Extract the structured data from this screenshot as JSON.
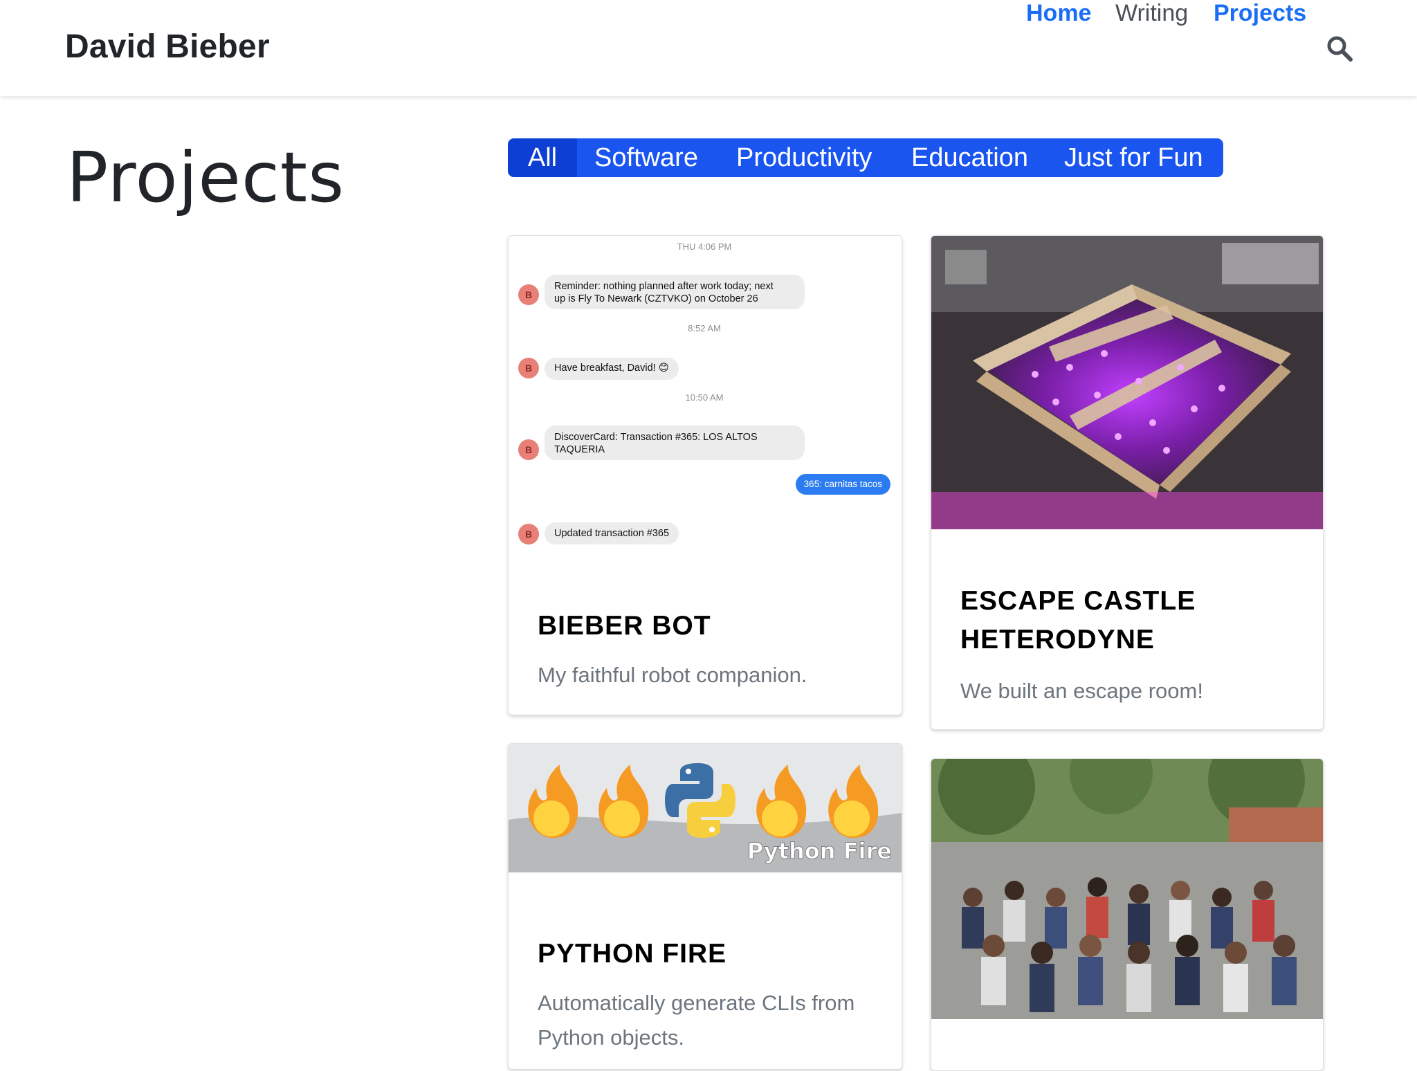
{
  "header": {
    "brand": "David Bieber",
    "nav": [
      {
        "label": "Home",
        "active": true
      },
      {
        "label": "Writing",
        "active": false
      },
      {
        "label": "Projects",
        "active": true
      }
    ]
  },
  "page": {
    "title": "Projects"
  },
  "filters": [
    {
      "label": "All",
      "selected": true
    },
    {
      "label": "Software",
      "selected": false
    },
    {
      "label": "Productivity",
      "selected": false
    },
    {
      "label": "Education",
      "selected": false
    },
    {
      "label": "Just for Fun",
      "selected": false
    }
  ],
  "cards": [
    {
      "title": "BIEBER BOT",
      "description": "My faithful robot companion.",
      "chat": {
        "times": [
          "THU 4:06 PM",
          "8:52 AM",
          "10:50 AM"
        ],
        "avatar_letter": "B",
        "messages": [
          {
            "line1": "Reminder: nothing planned after work today; next",
            "line2": "up is Fly To Newark (CZTVKO) on October 26"
          },
          {
            "line1": "Have breakfast, David! 😊"
          },
          {
            "line1": "DiscoverCard: Transaction #365: LOS ALTOS",
            "line2": "TAQUERIA"
          },
          {
            "line1": "Updated transaction #365"
          }
        ],
        "reply": "365: carnitas tacos"
      }
    },
    {
      "title_line1": "ESCAPE CASTLE",
      "title_line2": "HETERODYNE",
      "description": "We built an escape room!"
    },
    {
      "title": "PYTHON FIRE",
      "description_line1": "Automatically generate CLIs from",
      "description_line2": "Python objects.",
      "banner_text": "Python Fire"
    },
    {
      "title": ""
    }
  ],
  "colors": {
    "accent": "#1a6ef5",
    "filter_bg": "#1a55f0",
    "filter_selected": "#0d3fd4"
  },
  "icons": [
    "search-icon",
    "fire-icon",
    "python-logo-icon"
  ]
}
